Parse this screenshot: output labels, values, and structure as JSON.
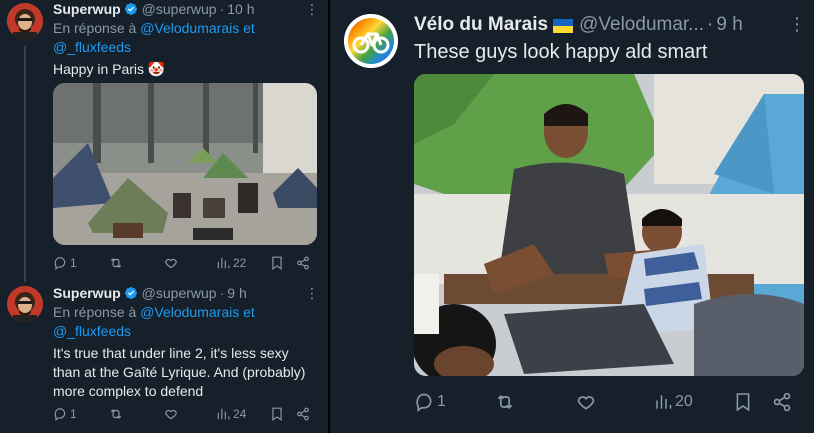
{
  "left_thread": {
    "tweet1": {
      "author_name": "Superwup",
      "handle": "@superwup",
      "time": "10 h",
      "reply_prefix": "En réponse à",
      "reply_mention1": "@Velodumarais",
      "reply_and": "et",
      "reply_mention2": "@_fluxfeeds",
      "text": "Happy in Paris 🤡",
      "stats": {
        "replies": "1",
        "retweets": "",
        "likes": "",
        "views": "22"
      }
    },
    "tweet2": {
      "author_name": "Superwup",
      "handle": "@superwup",
      "time": "9 h",
      "reply_prefix": "En réponse à",
      "reply_mention1": "@Velodumarais",
      "reply_and": "et",
      "reply_mention2": "@_fluxfeeds",
      "text_lines": [
        "It's true that under line 2, it's less sexy",
        "than at the Gaîté Lyrique. And (probably)",
        "more complex to defend"
      ],
      "stats": {
        "replies": "1",
        "retweets": "",
        "likes": "",
        "views": "24"
      }
    }
  },
  "right_tweet": {
    "author_name": "Vélo du Marais",
    "flag_emoji": "ukraine-flag-icon",
    "handle": "@Velodumar...",
    "time": "9 h",
    "text": "These guys look happy ald smart",
    "stats": {
      "replies": "1",
      "retweets": "",
      "likes": "",
      "views": "20"
    }
  },
  "separator": "·",
  "colors": {
    "background": "#15202b",
    "text": "#e7e9ea",
    "muted": "#8b98a5",
    "link": "#1d9bf0",
    "verified": "#1d9bf0"
  }
}
